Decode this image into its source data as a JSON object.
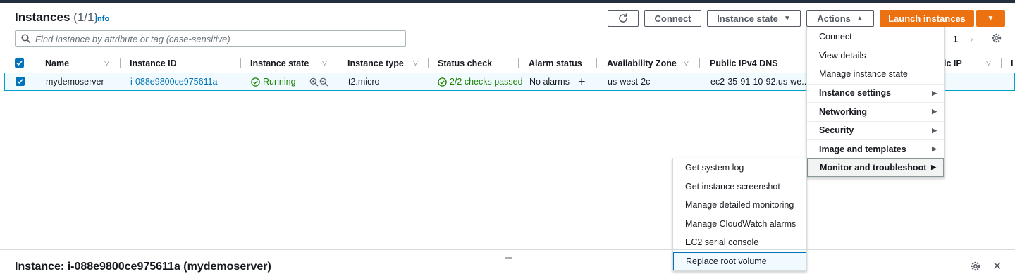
{
  "header": {
    "title": "Instances",
    "count": "(1/1)",
    "info": "Info"
  },
  "toolbar": {
    "connect": "Connect",
    "instance_state": "Instance state",
    "actions": "Actions",
    "launch": "Launch instances"
  },
  "search": {
    "placeholder": "Find instance by attribute or tag (case-sensitive)"
  },
  "pagination": {
    "page": "1"
  },
  "table": {
    "columns": [
      "Name",
      "Instance ID",
      "Instance state",
      "Instance type",
      "Status check",
      "Alarm status",
      "Availability Zone",
      "Public IPv4 DNS",
      "ic IP",
      "I"
    ],
    "row": {
      "name": "mydemoserver",
      "instance_id": "i-088e9800ce975611a",
      "state": "Running",
      "type": "t2.micro",
      "status": "2/2 checks passed",
      "alarm": "No alarms",
      "az": "us-west-2c",
      "dns": "ec2-35-91-10-92.us-we...",
      "tail": "–"
    }
  },
  "actions_menu": {
    "items": [
      {
        "label": "Connect",
        "bold": false
      },
      {
        "label": "View details",
        "bold": false
      },
      {
        "label": "Manage instance state",
        "bold": false
      },
      {
        "label": "Instance settings",
        "bold": true
      },
      {
        "label": "Networking",
        "bold": true
      },
      {
        "label": "Security",
        "bold": true
      },
      {
        "label": "Image and templates",
        "bold": true
      },
      {
        "label": "Monitor and troubleshoot",
        "bold": true
      }
    ]
  },
  "submenu": {
    "items": [
      "Get system log",
      "Get instance screenshot",
      "Manage detailed monitoring",
      "Manage CloudWatch alarms",
      "EC2 serial console",
      "Replace root volume"
    ]
  },
  "details": {
    "title": "Instance: i-088e9800ce975611a (mydemoserver)"
  },
  "colors": {
    "accent": "#0073bb",
    "launch": "#ec7211",
    "success": "#1d8102"
  }
}
